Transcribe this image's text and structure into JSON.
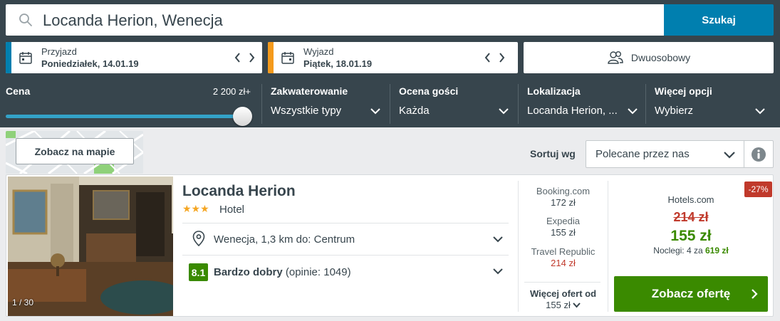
{
  "search": {
    "value": "Locanda Herion, Wenecja",
    "button_label": "Szukaj"
  },
  "checkin": {
    "label": "Przyjazd",
    "date": "Poniedziałek, 14.01.19",
    "accent_color": "#007faf"
  },
  "checkout": {
    "label": "Wyjazd",
    "date": "Piątek, 18.01.19",
    "accent_color": "#f49a1c"
  },
  "room": {
    "label": "Dwuosobowy"
  },
  "filters": {
    "price": {
      "label": "Cena",
      "value": "2 200 zł+",
      "slider_fraction": 1.0
    },
    "accommodation": {
      "label": "Zakwaterowanie",
      "value": "Wszystkie typy"
    },
    "guest_rating": {
      "label": "Ocena gości",
      "value": "Każda"
    },
    "location": {
      "label": "Lokalizacja",
      "value": "Locanda Herion, ..."
    },
    "more": {
      "label": "Więcej opcji",
      "value": "Wybierz"
    }
  },
  "map": {
    "button_label": "Zobacz na mapie"
  },
  "sort": {
    "label": "Sortuj wg",
    "value": "Polecane przez nas"
  },
  "hotel": {
    "name": "Locanda Herion",
    "stars": "★★★",
    "star_count": 3,
    "type": "Hotel",
    "photo_count": "1 / 30",
    "location": "Wenecja, 1,3 km do: Centrum",
    "rating_score": "8.1",
    "rating_label": "Bardzo dobry",
    "rating_reviews": "(opinie: 1049)"
  },
  "partners": [
    {
      "name": "Booking.com",
      "price": "172 zł",
      "highlight": false
    },
    {
      "name": "Expedia",
      "price": "155 zł",
      "highlight": false
    },
    {
      "name": "Travel Republic",
      "price": "214 zł",
      "highlight": true
    }
  ],
  "more_offers": {
    "label": "Więcej ofert od",
    "price": "155 zł"
  },
  "best_offer": {
    "discount": "-27%",
    "partner": "Hotels.com",
    "old_price": "214 zł",
    "new_price": "155 zł",
    "nights_prefix": "Noclegi: 4 za",
    "nights_total": "619 zł",
    "button_label": "Zobacz ofertę"
  },
  "colors": {
    "header_bg": "#37454d",
    "search_button": "#007faf",
    "deal_green": "#3a8a00",
    "discount_red": "#c0392b",
    "star_gold": "#f5a623"
  }
}
